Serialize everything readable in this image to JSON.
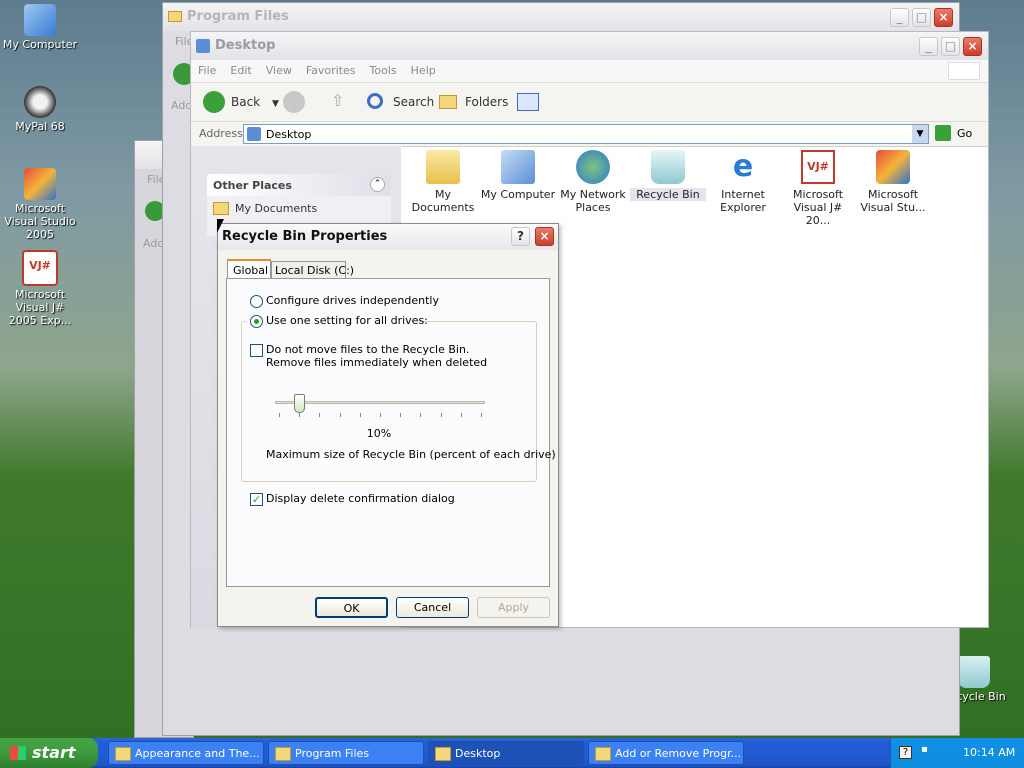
{
  "desktop": {
    "icons": [
      {
        "label": "My Computer",
        "icon": "my-computer-icon"
      },
      {
        "label": "MyPal 68",
        "icon": "mypal-icon"
      },
      {
        "label": "Microsoft Visual Studio 2005",
        "icon": "visual-studio-icon"
      },
      {
        "label": "Microsoft Visual J# 2005 Exp...",
        "icon": "vj-sharp-icon"
      },
      {
        "label": "Recycle Bin",
        "icon": "recycle-bin-icon"
      }
    ]
  },
  "windows": {
    "program_files": {
      "title": "Program Files",
      "menu_fragment": "File",
      "addr_fragment": "Add"
    },
    "back1": {
      "menu_fragment": "File",
      "addr_fragment": "Add"
    },
    "desktop": {
      "title": "Desktop",
      "menu": [
        "File",
        "Edit",
        "View",
        "Favorites",
        "Tools",
        "Help"
      ],
      "toolbar": {
        "back": "Back",
        "search": "Search",
        "folders": "Folders"
      },
      "address_label": "Address",
      "address_value": "Desktop",
      "go": "Go",
      "other_places": {
        "title": "Other Places",
        "items": [
          "My Documents"
        ]
      },
      "files": [
        {
          "label": "My Documents",
          "icon": "my-documents-icon"
        },
        {
          "label": "My Computer",
          "icon": "my-computer-icon"
        },
        {
          "label": "My Network Places",
          "icon": "network-places-icon"
        },
        {
          "label": "Recycle Bin",
          "icon": "recycle-bin-icon"
        },
        {
          "label": "Internet Explorer",
          "icon": "internet-explorer-icon"
        },
        {
          "label": "Microsoft Visual J# 20...",
          "icon": "vj-sharp-icon"
        },
        {
          "label": "Microsoft Visual Stu...",
          "icon": "visual-studio-icon"
        }
      ]
    }
  },
  "dialog": {
    "title": "Recycle Bin Properties",
    "help": "?",
    "tabs": [
      "Global",
      "Local Disk (C:)"
    ],
    "radio_independent": "Configure drives independently",
    "radio_one": "Use one setting for all drives:",
    "check_no_move_line1": "Do not move files to the Recycle Bin.",
    "check_no_move_line2": "Remove files immediately when deleted",
    "slider_value": "10%",
    "slider_fraction": 0.1,
    "slider_caption": "Maximum size of Recycle Bin (percent of each drive)",
    "check_confirm": "Display delete confirmation dialog",
    "ok": "OK",
    "cancel": "Cancel",
    "apply": "Apply"
  },
  "taskbar": {
    "start": "start",
    "tasks": [
      "Appearance and The...",
      "Program Files",
      "Desktop",
      "Add or Remove Progr..."
    ],
    "clock": "10:14 AM"
  },
  "colors": {
    "taskbar": "#245edb",
    "start": "#3c9a3c",
    "accent": "#1c5180"
  }
}
